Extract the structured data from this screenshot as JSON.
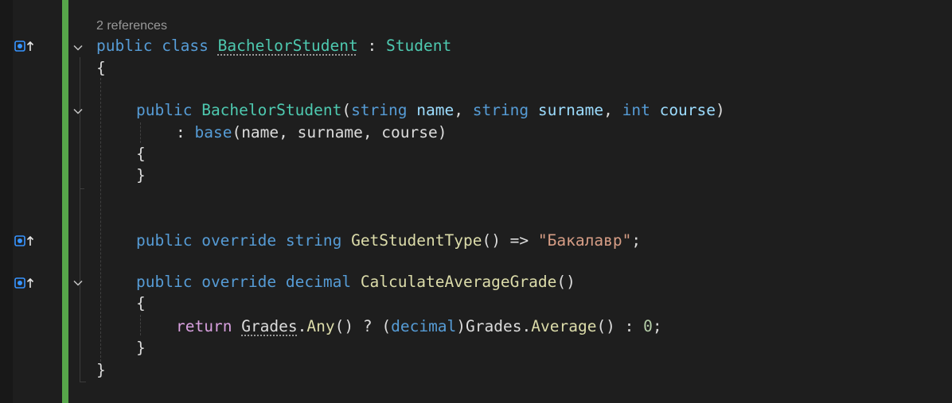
{
  "codelens": {
    "references": "2 references"
  },
  "lines": {
    "l1": {
      "kw1": "public",
      "kw2": "class",
      "name": "BachelorStudent",
      "colon": " : ",
      "base": "Student"
    },
    "l2": {
      "text": "{"
    },
    "l3": {
      "kw1": "public",
      "ctor": "BachelorStudent",
      "open": "(",
      "t1": "string",
      "p1": "name",
      "c1": ", ",
      "t2": "string",
      "p2": "surname",
      "c2": ", ",
      "t3": "int",
      "p3": "course",
      "close": ")"
    },
    "l4": {
      "colon": ": ",
      "base_kw": "base",
      "args": "(name, surname, course)"
    },
    "l5": {
      "text": "{"
    },
    "l6": {
      "text": "}"
    },
    "l7": {
      "kw1": "public",
      "kw2": "override",
      "kw3": "string",
      "method": "GetStudentType",
      "parens": "()",
      "arrow": " => ",
      "str": "\"Бакалавр\"",
      "semi": ";"
    },
    "l8": {
      "kw1": "public",
      "kw2": "override",
      "kw3": "decimal",
      "method": "CalculateAverageGrade",
      "parens": "()"
    },
    "l9": {
      "text": "{"
    },
    "l10": {
      "ret": "return",
      "grades1": "Grades",
      "dot1": ".",
      "any": "Any",
      "p1": "()",
      "q": " ? ",
      "cast_open": "(",
      "decimal": "decimal",
      "cast_close": ")",
      "grades2": "Grades",
      "dot2": ".",
      "avg": "Average",
      "p2": "()",
      "colon": " : ",
      "zero": "0",
      "semi": ";"
    },
    "l11": {
      "text": "}"
    },
    "l12": {
      "text": "}"
    }
  },
  "colors": {
    "background": "#1e1e1e",
    "change_bar": "#57a64a",
    "keyword": "#569cd6",
    "control_keyword": "#d8a0df",
    "type": "#4ec9b0",
    "method": "#dcdcaa",
    "parameter": "#9cdcfe",
    "string": "#d69d85",
    "number": "#b5cea8",
    "punctuation": "#dcdcdc"
  },
  "icons": {
    "override_glyph": "override-up-arrow-icon",
    "fold": "chevron-down-icon"
  }
}
